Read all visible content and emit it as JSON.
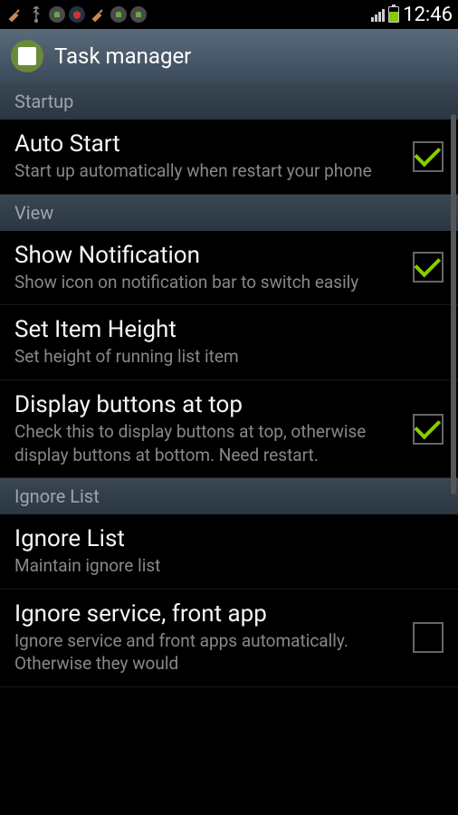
{
  "statusBar": {
    "time": "12:46"
  },
  "header": {
    "title": "Task manager"
  },
  "sections": {
    "startup": {
      "label": "Startup",
      "autoStart": {
        "title": "Auto Start",
        "subtitle": "Start up automatically when restart your phone",
        "checked": true
      }
    },
    "view": {
      "label": "View",
      "showNotification": {
        "title": "Show Notification",
        "subtitle": "Show icon on notification bar to switch easily",
        "checked": true
      },
      "setItemHeight": {
        "title": "Set Item Height",
        "subtitle": "Set height of running list item"
      },
      "displayButtons": {
        "title": "Display buttons at top",
        "subtitle": "Check this to display buttons at top, otherwise display buttons at bottom. Need restart.",
        "checked": true
      }
    },
    "ignoreList": {
      "label": "Ignore List",
      "ignoreList": {
        "title": "Ignore List",
        "subtitle": "Maintain ignore list"
      },
      "ignoreService": {
        "title": "Ignore service, front app",
        "subtitle": "Ignore service and front apps automatically. Otherwise they would",
        "checked": false
      }
    }
  }
}
